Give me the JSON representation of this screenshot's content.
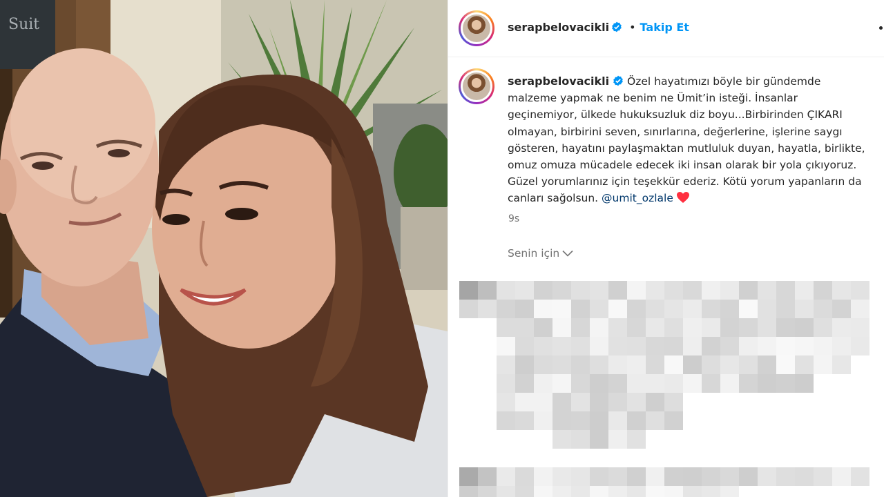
{
  "post": {
    "username": "serapbelovacikli",
    "follow_label": "Takip Et",
    "dot": "•",
    "caption_lines": [
      "Özel hayatımızı böyle bir gündemde",
      "malzeme yapmak ne benim ne Ümit’in isteği. İnsanlar",
      "geçinemiyor, ülkede hukuksuzluk diz boyu...Birbirinden ÇIKARI",
      "olmayan, birbirini seven, sınırlarına, değerlerine, işlerine saygı",
      "gösteren, hayatını paylaşmaktan mutluluk duyan, hayatla, birlikte,",
      "omuz omuza mücadele edecek iki insan olarak bir yola çıkıyoruz.",
      "Güzel yorumlarınız için teşekkür ederiz. Kötü yorum yapanların da",
      "canları sağolsun."
    ],
    "mention": "@umit_ozlale",
    "time": "9s",
    "sort_label": "Senin için"
  },
  "colors": {
    "link": "#0095f6",
    "mention": "#00376b",
    "verified": "#0095f6",
    "heart": "#ff3040",
    "muted": "#737373"
  },
  "photo": {
    "sign_text": "Suit"
  }
}
